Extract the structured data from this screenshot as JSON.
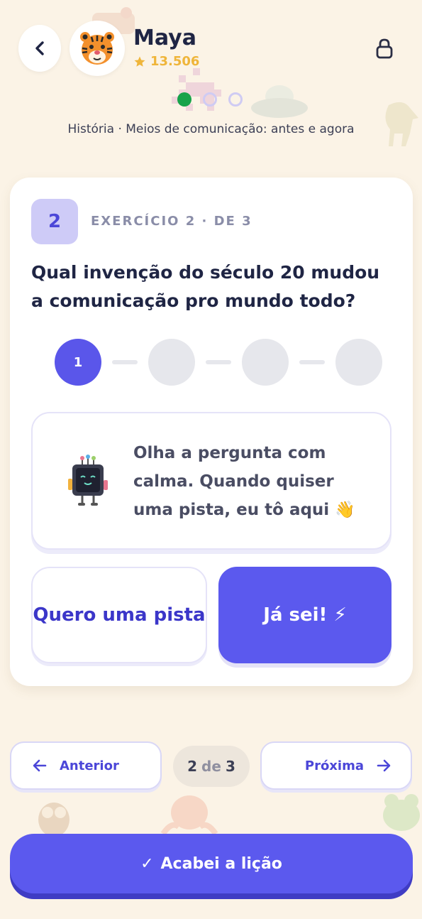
{
  "header": {
    "user_name": "Maya",
    "points": "13.506",
    "back_icon": "chevron-left-icon",
    "avatar_icon": "tiger-avatar",
    "lock_icon": "lock-icon"
  },
  "progress": {
    "total": 3,
    "completed": 1
  },
  "breadcrumb": {
    "subject": "História",
    "separator": "·",
    "topic": "Meios de comunicação: antes e agora"
  },
  "exercise": {
    "number": "2",
    "label": "EXERCÍCIO 2 · DE 3",
    "question": "Qual invenção do século 20 mudou a comunicação pro mundo todo?",
    "steps": [
      {
        "label": "1",
        "active": true
      },
      {
        "label": "",
        "active": false
      },
      {
        "label": "",
        "active": false
      },
      {
        "label": "",
        "active": false
      }
    ]
  },
  "tip": {
    "text": "Olha a pergunta com calma. Quando quiser uma pista, eu tô aqui 👋",
    "icon": "robot-mascot-icon"
  },
  "actions": {
    "hint_label": "Quero uma pista",
    "answer_label": "Já sei! ⚡"
  },
  "pager": {
    "prev_label": "Anterior",
    "next_label": "Próxima",
    "current": "2",
    "of": "de",
    "total": "3"
  },
  "finish": {
    "label": "Acabei a lição",
    "check": "✓"
  },
  "colors": {
    "background": "#fbf3e6",
    "primary": "#5b59ee",
    "success": "#17a34a",
    "points": "#efb53a"
  }
}
